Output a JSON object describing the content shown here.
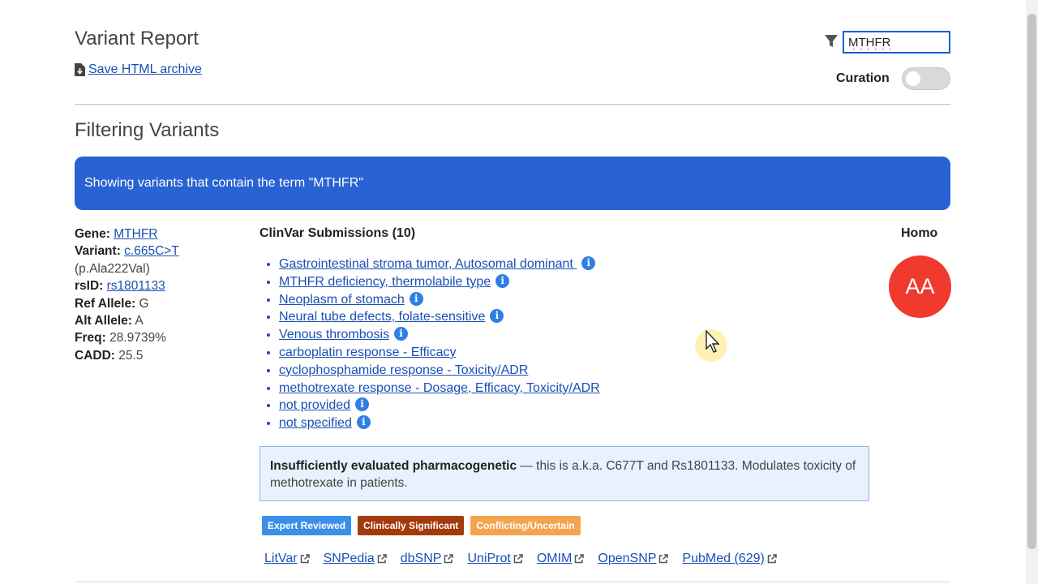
{
  "header": {
    "title": "Variant Report",
    "save_link": "Save HTML archive",
    "search_value": "MTHFR",
    "curation_label": "Curation"
  },
  "section": {
    "title": "Filtering Variants",
    "banner": "Showing variants that contain the term \"MTHFR\""
  },
  "variant": {
    "gene_label": "Gene:",
    "gene": "MTHFR",
    "variant_label": "Variant:",
    "variant": "c.665C>T",
    "protein": "(p.Ala222Val)",
    "rsid_label": "rsID:",
    "rsid": "rs1801133",
    "ref_label": "Ref Allele:",
    "ref": "G",
    "alt_label": "Alt Allele:",
    "alt": "A",
    "freq_label": "Freq:",
    "freq": "28.9739%",
    "cadd_label": "CADD:",
    "cadd": "25.5"
  },
  "clinvar": {
    "heading": "ClinVar Submissions (10)",
    "conditions": [
      {
        "label": "Gastrointestinal stroma tumor, Autosomal dominant ",
        "info": true
      },
      {
        "label": "MTHFR deficiency, thermolabile type",
        "info": true
      },
      {
        "label": "Neoplasm of stomach",
        "info": true
      },
      {
        "label": "Neural tube defects, folate-sensitive",
        "info": true
      },
      {
        "label": "Venous thrombosis",
        "info": true
      },
      {
        "label": "carboplatin response - Efficacy",
        "info": false
      },
      {
        "label": "cyclophosphamide response - Toxicity/ADR",
        "info": false
      },
      {
        "label": "methotrexate response - Dosage, Efficacy, Toxicity/ADR",
        "info": false
      },
      {
        "label": "not provided",
        "info": true
      },
      {
        "label": "not specified",
        "info": true
      }
    ]
  },
  "zygosity": {
    "label": "Homo",
    "genotype": "AA",
    "color": "#f03a2e"
  },
  "note": {
    "bold": "Insufficiently evaluated pharmacogenetic",
    "text": " — this is a.k.a. C677T and Rs1801133. Modulates toxicity of methotrexate in patients."
  },
  "badges": [
    {
      "label": "Expert Reviewed",
      "color": "#3b8fe8"
    },
    {
      "label": "Clinically Significant",
      "color": "#a33a0b"
    },
    {
      "label": "Conflicting/Uncertain",
      "color": "#f5a44e"
    }
  ],
  "external_links": [
    "LitVar",
    "SNPedia",
    "dbSNP",
    "UniProt",
    "OMIM",
    "OpenSNP",
    "PubMed (629)"
  ],
  "icons": {
    "filter": "filter-icon",
    "download": "file-download-icon",
    "external": "external-link-icon",
    "info": "info-icon"
  },
  "colors": {
    "banner": "#2962d2",
    "link": "#1a4fb5",
    "info_badge": "#2f7fe4"
  }
}
